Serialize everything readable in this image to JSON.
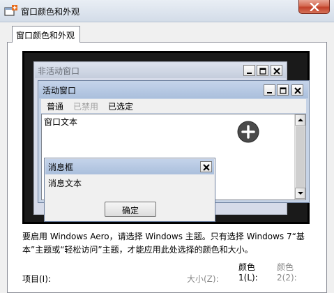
{
  "window": {
    "title": "窗口颜色和外观",
    "accent_color": "#c2412a",
    "icons": {
      "app": "paint-palette-add-icon",
      "close": "close-icon"
    }
  },
  "tabs": [
    {
      "label": "窗口颜色和外观"
    }
  ],
  "preview": {
    "inactive_window": {
      "title": "非活动窗口"
    },
    "active_window": {
      "title": "活动窗口",
      "menu": {
        "normal": "普通",
        "disabled": "已禁用",
        "selected": "已选定"
      },
      "content_text": "窗口文本"
    },
    "message_box": {
      "title": "消息框",
      "text": "消息文本",
      "ok_label": "确定"
    }
  },
  "info_text": "要启用 Windows Aero，请选择 Windows 主题。只有选择 Windows 7“基本”主题或“轻松访问”主题，才能应用此处选择的颜色和大小。",
  "fields": {
    "item_label": "项目(I):",
    "size_label": "大小(Z):",
    "color1_header": "颜色",
    "color1_label": "1(L):",
    "color2_header": "颜色",
    "color2_label": "2(2):"
  }
}
